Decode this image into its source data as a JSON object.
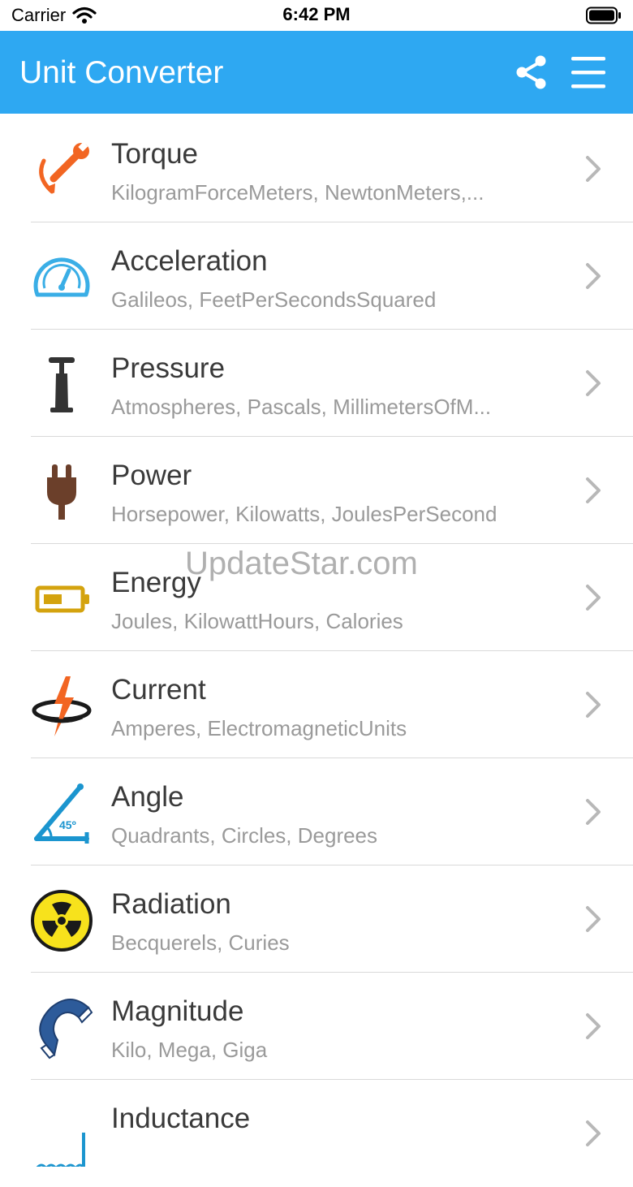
{
  "status_bar": {
    "carrier": "Carrier",
    "time": "6:42 PM"
  },
  "nav": {
    "title": "Unit Converter",
    "share_icon": "share-icon",
    "menu_icon": "hamburger-menu-icon",
    "color": "#2ea8f2"
  },
  "items": [
    {
      "title": "Torque",
      "subtitle": "KilogramForceMeters, NewtonMeters,...",
      "icon": "wrench-icon"
    },
    {
      "title": "Acceleration",
      "subtitle": "Galileos, FeetPerSecondsSquared",
      "icon": "speedometer-icon"
    },
    {
      "title": "Pressure",
      "subtitle": "Atmospheres, Pascals, MillimetersOfM...",
      "icon": "pump-icon"
    },
    {
      "title": "Power",
      "subtitle": "Horsepower, Kilowatts, JoulesPerSecond",
      "icon": "plug-icon"
    },
    {
      "title": "Energy",
      "subtitle": "Joules, KilowattHours, Calories",
      "icon": "battery-icon"
    },
    {
      "title": "Current",
      "subtitle": "Amperes, ElectromagneticUnits",
      "icon": "lightning-ring-icon"
    },
    {
      "title": "Angle",
      "subtitle": "Quadrants, Circles, Degrees",
      "icon": "protractor-angle-icon"
    },
    {
      "title": "Radiation",
      "subtitle": "Becquerels, Curies",
      "icon": "radiation-icon"
    },
    {
      "title": "Magnitude",
      "subtitle": "Kilo, Mega, Giga",
      "icon": "magnet-icon"
    },
    {
      "title": "Inductance",
      "subtitle": "",
      "icon": "coil-icon"
    }
  ],
  "icon_labels": {
    "angle_degrees": "45º"
  },
  "watermark": "UpdateStar.com"
}
